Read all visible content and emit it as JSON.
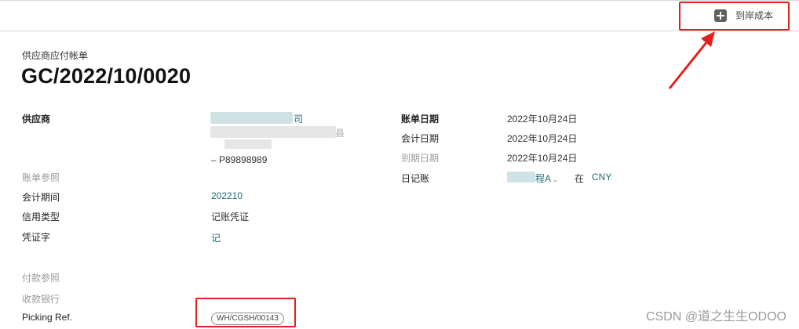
{
  "toolbar": {
    "landed_cost_label": "到岸成本",
    "landed_cost_icon": "plus-square-icon"
  },
  "header": {
    "doc_type": "供应商应付帐单",
    "title": "GC/2022/10/0020"
  },
  "fields": {
    "vendor_label": "供应商",
    "vendor_line1_suffix": "司",
    "vendor_line2_suffix": "县",
    "vendor_code": "– P89898989",
    "bill_ref_label": "账单参照",
    "period_label": "会计期间",
    "period_value": "202210",
    "credit_type_label": "信用类型",
    "credit_type_value": "记账凭证",
    "voucher_label": "凭证字",
    "voucher_value": "记",
    "payment_ref_label": "付款参照",
    "receiving_bank_label": "收款银行",
    "picking_ref_label": "Picking Ref.",
    "picking_ref_value": "WH/CGSH/00143",
    "bill_date_label": "账单日期",
    "bill_date_value": "2022年10月24日",
    "accounting_date_label": "会计日期",
    "accounting_date_value": "2022年10月24日",
    "due_date_label": "到期日期",
    "due_date_value": "2022年10月24日",
    "journal_label": "日记账",
    "journal_value_suffix": "程A",
    "journal_in": "在",
    "currency": "CNY"
  },
  "watermark": "CSDN @道之生生ODOO",
  "colors": {
    "highlight": "#e3201b",
    "link": "#1f6b75"
  }
}
